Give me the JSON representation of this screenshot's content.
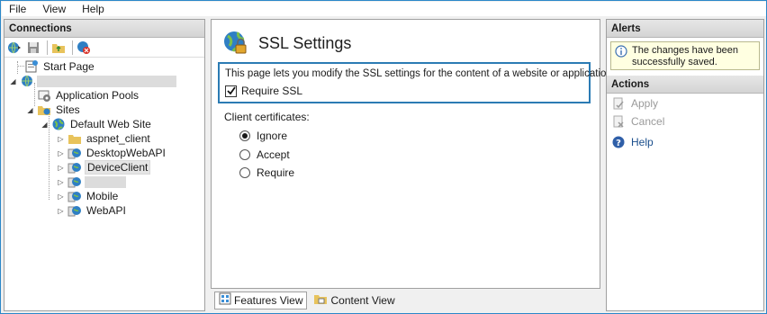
{
  "menu": {
    "items": [
      "File",
      "View",
      "Help"
    ]
  },
  "connections": {
    "title": "Connections",
    "tree": {
      "start_page": "Start Page",
      "server": "",
      "app_pools": "Application Pools",
      "sites": "Sites",
      "default_site": "Default Web Site",
      "children": [
        "aspnet_client",
        "DesktopWebAPI",
        "DeviceClient",
        "",
        "Mobile",
        "WebAPI"
      ]
    }
  },
  "main": {
    "title": "SSL Settings",
    "description": "This page lets you modify the SSL settings for the content of a website or application.",
    "require_ssl_label": "Require SSL",
    "require_ssl_checked": true,
    "client_certificates_label": "Client certificates:",
    "options": [
      "Ignore",
      "Accept",
      "Require"
    ],
    "selected_option": "Ignore"
  },
  "view_tabs": {
    "features": "Features View",
    "content": "Content View",
    "active": "Features View"
  },
  "alerts": {
    "title": "Alerts",
    "message": "The changes have been successfully saved."
  },
  "actions": {
    "title": "Actions",
    "apply": "Apply",
    "cancel": "Cancel",
    "help": "Help"
  },
  "colors": {
    "accent": "#2b7bb4",
    "alert_bg": "#ffffe1",
    "link": "#1a4e8c"
  }
}
